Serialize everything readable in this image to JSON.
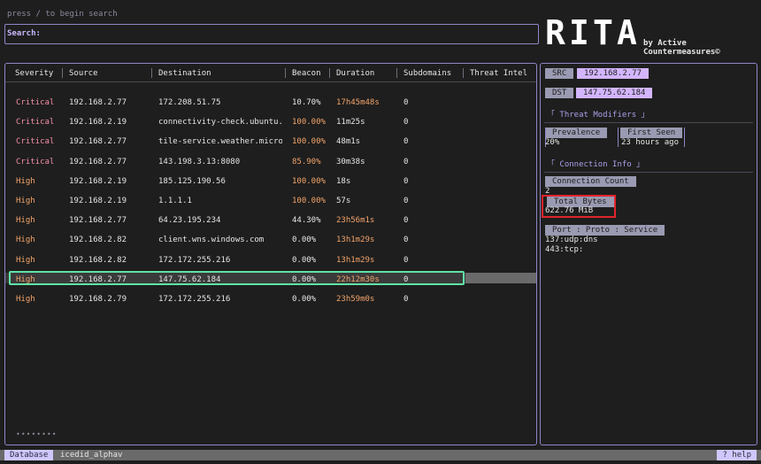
{
  "search": {
    "hint": "press / to begin search",
    "label": "Search:"
  },
  "logo": {
    "letters": [
      "R",
      "I",
      "T",
      "A"
    ],
    "byline": "by Active Countermeasures©"
  },
  "table": {
    "columns": [
      "Severity",
      "Source",
      "Destination",
      "Beacon",
      "Duration",
      "Subdomains",
      "Threat Intel"
    ],
    "rows": [
      {
        "severity": "Critical",
        "source": "192.168.2.77",
        "destination": "172.208.51.75",
        "beacon": "10.70%",
        "duration": "17h45m48s",
        "subdomains": "0"
      },
      {
        "severity": "Critical",
        "source": "192.168.2.19",
        "destination": "connectivity-check.ubuntu.…",
        "beacon": "100.00%",
        "duration": "11m25s",
        "subdomains": "0"
      },
      {
        "severity": "Critical",
        "source": "192.168.2.77",
        "destination": "tile-service.weather.micro…",
        "beacon": "100.00%",
        "duration": "48m1s",
        "subdomains": "0"
      },
      {
        "severity": "Critical",
        "source": "192.168.2.77",
        "destination": "143.198.3.13:8080",
        "beacon": "85.90%",
        "duration": "30m38s",
        "subdomains": "0"
      },
      {
        "severity": "High",
        "source": "192.168.2.19",
        "destination": "185.125.190.56",
        "beacon": "100.00%",
        "duration": "18s",
        "subdomains": "0"
      },
      {
        "severity": "High",
        "source": "192.168.2.19",
        "destination": "1.1.1.1",
        "beacon": "100.00%",
        "duration": "57s",
        "subdomains": "0"
      },
      {
        "severity": "High",
        "source": "192.168.2.77",
        "destination": "64.23.195.234",
        "beacon": "44.30%",
        "duration": "23h56m1s",
        "subdomains": "0"
      },
      {
        "severity": "High",
        "source": "192.168.2.82",
        "destination": "client.wns.windows.com",
        "beacon": "0.00%",
        "duration": "13h1m29s",
        "subdomains": "0"
      },
      {
        "severity": "High",
        "source": "192.168.2.82",
        "destination": "172.172.255.216",
        "beacon": "0.00%",
        "duration": "13h1m29s",
        "subdomains": "0"
      },
      {
        "severity": "High",
        "source": "192.168.2.77",
        "destination": "147.75.62.184",
        "beacon": "0.00%",
        "duration": "22h12m30s",
        "subdomains": "0"
      },
      {
        "severity": "High",
        "source": "192.168.2.79",
        "destination": "172.172.255.216",
        "beacon": "0.00%",
        "duration": "23h59m0s",
        "subdomains": "0"
      }
    ],
    "pager": "••••••••"
  },
  "details": {
    "src_label": "SRC",
    "src_value": "192.168.2.77",
    "dst_label": "DST",
    "dst_value": "147.75.62.184",
    "threat_modifiers_title": "「 Threat Modifiers 」",
    "prevalence_label": "Prevalence",
    "prevalence_value": "20%",
    "first_seen_label": "First Seen",
    "first_seen_value": "23 hours ago",
    "connection_info_title": "「 Connection Info 」",
    "conn_count_label": "Connection Count",
    "conn_count_value": "2",
    "total_bytes_label": "Total Bytes",
    "total_bytes_value": "622.76 MiB",
    "port_label": "Port : Proto : Service",
    "ports": [
      "137:udp:dns",
      "443:tcp:"
    ]
  },
  "footer": {
    "db_label": "Database",
    "db_name": "icedid_alphav",
    "help": "? help"
  },
  "colors": {
    "accent": "#8e86c8",
    "critical": "#f58fa8",
    "high": "#f3a46a",
    "selection": "#5fe3a6",
    "highlight": "#e0242b"
  }
}
